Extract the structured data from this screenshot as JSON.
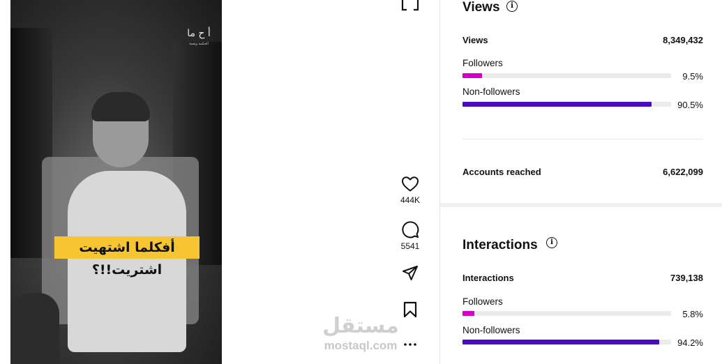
{
  "video": {
    "caption": "أفكلما اشتهيت اشتريت!!؟",
    "logo_text": "أ ح ما",
    "logo_sub": "الحكمة ونعمة"
  },
  "actions": {
    "expand_icon": "expand-icon",
    "like_icon": "heart-icon",
    "like_count": "444K",
    "comment_icon": "comment-icon",
    "comment_count": "5541",
    "share_icon": "send-icon",
    "save_icon": "bookmark-icon",
    "more_icon": "more-icon"
  },
  "watermark": {
    "arabic": "مستقل",
    "latin": "mostaql.com"
  },
  "views": {
    "title": "Views",
    "total_label": "Views",
    "total_value": "8,349,432",
    "followers_label": "Followers",
    "followers_pct": "9.5%",
    "followers_fraction": 0.095,
    "nonfollowers_label": "Non-followers",
    "nonfollowers_pct": "90.5%",
    "nonfollowers_fraction": 0.905,
    "reached_label": "Accounts reached",
    "reached_value": "6,622,099"
  },
  "interactions": {
    "title": "Interactions",
    "total_label": "Interactions",
    "total_value": "739,138",
    "followers_label": "Followers",
    "followers_pct": "5.8%",
    "followers_fraction": 0.058,
    "nonfollowers_label": "Non-followers",
    "nonfollowers_pct": "94.2%",
    "nonfollowers_fraction": 0.942
  },
  "colors": {
    "followers": "#d300c5",
    "nonfollowers": "#4a0ac0",
    "caption_bg": "#f7c531"
  }
}
